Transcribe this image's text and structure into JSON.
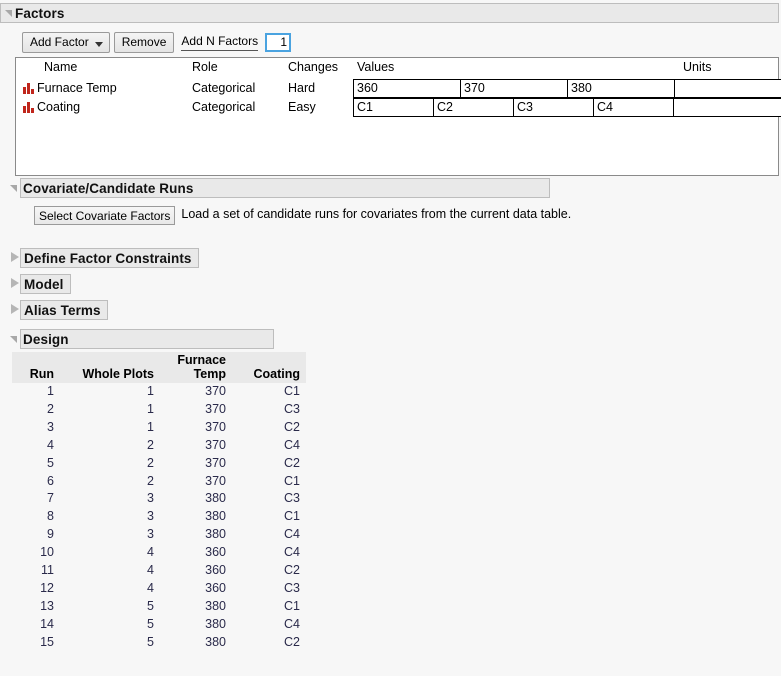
{
  "factors": {
    "section_title": "Factors",
    "toolbar": {
      "add_factor_label": "Add Factor",
      "remove_label": "Remove",
      "add_n_factors_label": "Add N Factors",
      "add_n_factors_value": "1"
    },
    "columns": {
      "name": "Name",
      "role": "Role",
      "changes": "Changes",
      "values": "Values",
      "units": "Units"
    },
    "rows": [
      {
        "icon": "categorical-bar-icon",
        "name": "Furnace Temp",
        "role": "Categorical",
        "changes": "Hard",
        "levels": [
          "360",
          "370",
          "380"
        ],
        "units": ""
      },
      {
        "icon": "categorical-bar-icon",
        "name": "Coating",
        "role": "Categorical",
        "changes": "Easy",
        "levels": [
          "C1",
          "C2",
          "C3",
          "C4"
        ],
        "units": ""
      }
    ]
  },
  "covariate": {
    "section_title": "Covariate/Candidate Runs",
    "select_button_label": "Select Covariate Factors",
    "description": "Load a set of candidate runs for covariates from the current data table."
  },
  "collapsed_sections": [
    {
      "title": "Define Factor Constraints"
    },
    {
      "title": "Model"
    },
    {
      "title": "Alias Terms"
    }
  ],
  "design": {
    "section_title": "Design",
    "columns": [
      "Run",
      "Whole Plots",
      "Furnace Temp",
      "Coating"
    ],
    "column_lines": [
      [
        "Run"
      ],
      [
        "Whole Plots"
      ],
      [
        "Furnace",
        "Temp"
      ],
      [
        "Coating"
      ]
    ],
    "rows": [
      {
        "run": "1",
        "whole_plots": "1",
        "furnace_temp": "370",
        "coating": "C1"
      },
      {
        "run": "2",
        "whole_plots": "1",
        "furnace_temp": "370",
        "coating": "C3"
      },
      {
        "run": "3",
        "whole_plots": "1",
        "furnace_temp": "370",
        "coating": "C2"
      },
      {
        "run": "4",
        "whole_plots": "2",
        "furnace_temp": "370",
        "coating": "C4"
      },
      {
        "run": "5",
        "whole_plots": "2",
        "furnace_temp": "370",
        "coating": "C2"
      },
      {
        "run": "6",
        "whole_plots": "2",
        "furnace_temp": "370",
        "coating": "C1"
      },
      {
        "run": "7",
        "whole_plots": "3",
        "furnace_temp": "380",
        "coating": "C3"
      },
      {
        "run": "8",
        "whole_plots": "3",
        "furnace_temp": "380",
        "coating": "C1"
      },
      {
        "run": "9",
        "whole_plots": "3",
        "furnace_temp": "380",
        "coating": "C4"
      },
      {
        "run": "10",
        "whole_plots": "4",
        "furnace_temp": "360",
        "coating": "C4"
      },
      {
        "run": "11",
        "whole_plots": "4",
        "furnace_temp": "360",
        "coating": "C2"
      },
      {
        "run": "12",
        "whole_plots": "4",
        "furnace_temp": "360",
        "coating": "C3"
      },
      {
        "run": "13",
        "whole_plots": "5",
        "furnace_temp": "380",
        "coating": "C1"
      },
      {
        "run": "14",
        "whole_plots": "5",
        "furnace_temp": "380",
        "coating": "C4"
      },
      {
        "run": "15",
        "whole_plots": "5",
        "furnace_temp": "380",
        "coating": "C2"
      }
    ]
  },
  "colors": {
    "factor_icon": "#c0261c",
    "focus_border": "#4aa3e0",
    "bar_background": "#e9e9e9",
    "data_text": "#2a2a4a"
  }
}
